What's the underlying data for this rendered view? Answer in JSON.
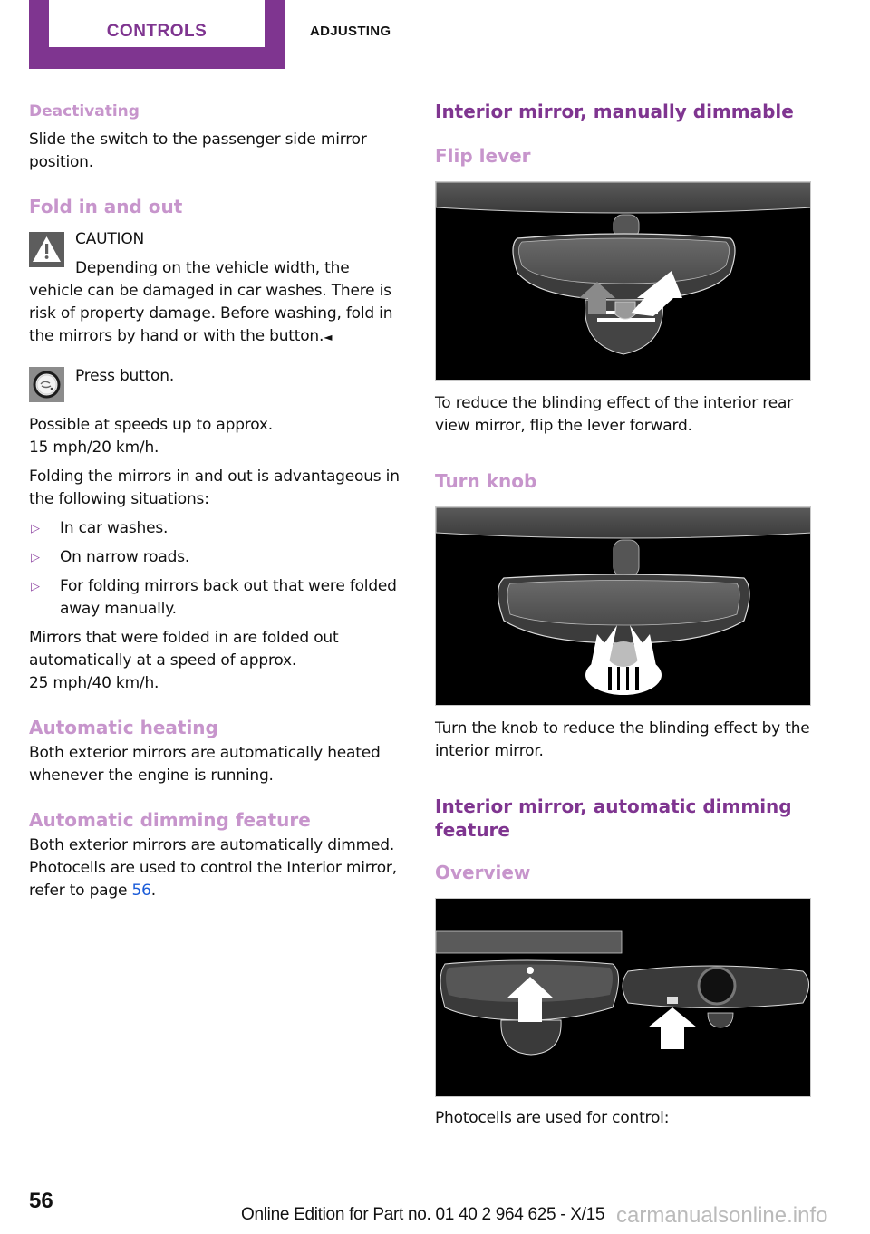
{
  "header": {
    "chapter_tab": "CONTROLS",
    "section": "ADJUSTING"
  },
  "colors": {
    "brand_purple": "#7f3590",
    "subheading_lilac": "#c795cc",
    "link_blue": "#1a5bd8"
  },
  "left": {
    "deactivating": {
      "heading": "Deactivating",
      "text": "Slide the switch to the passenger side mirror position."
    },
    "fold": {
      "heading": "Fold in and out",
      "caution_icon": "warning-triangle-icon",
      "caution_title": "CAUTION",
      "caution_text": "Depending on the vehicle width, the vehicle can be damaged in car washes. There is risk of property damage. Before washing, fold in the mirrors by hand or with the button.",
      "caution_end_mark": "◄",
      "button_icon": "mirror-fold-button-icon",
      "button_text": "Press button.",
      "speed_text_1": "Possible at speeds up to approx.",
      "speed_text_2": "15 mph/20 km/h.",
      "situations_intro": "Folding the mirrors in and out is advantageous in the following situations:",
      "bullet_glyph": "▷",
      "situations": [
        "In car washes.",
        "On narrow roads.",
        "For folding mirrors back out that were folded away manually."
      ],
      "auto_out_1": "Mirrors that were folded in are folded out automatically at a speed of approx.",
      "auto_out_2": "25 mph/40 km/h."
    },
    "heating": {
      "heading": "Automatic heating",
      "text": "Both exterior mirrors are automatically heated whenever the engine is running."
    },
    "dimming": {
      "heading": "Automatic dimming feature",
      "text_before_link": "Both exterior mirrors are automatically dimmed. Photocells are used to control the Interior mirror, refer to page ",
      "link": "56",
      "text_after_link": "."
    }
  },
  "right": {
    "manual": {
      "heading": "Interior mirror, manually dimmable",
      "flip_heading": "Flip lever",
      "flip_image": "flip-lever-illustration",
      "flip_text": "To reduce the blinding effect of the interior rear view mirror, flip the lever forward.",
      "knob_heading": "Turn knob",
      "knob_image": "turn-knob-illustration",
      "knob_text": "Turn the knob to reduce the blinding effect by the interior mirror."
    },
    "automatic": {
      "heading": "Interior mirror, automatic dimming feature",
      "overview_heading": "Overview",
      "overview_image": "photocells-illustration",
      "overview_text": "Photocells are used for control:"
    }
  },
  "footer": {
    "page_number": "56",
    "edition": "Online Edition for Part no. 01 40 2 964 625 - X/15",
    "watermark": "carmanualsonline.info"
  }
}
